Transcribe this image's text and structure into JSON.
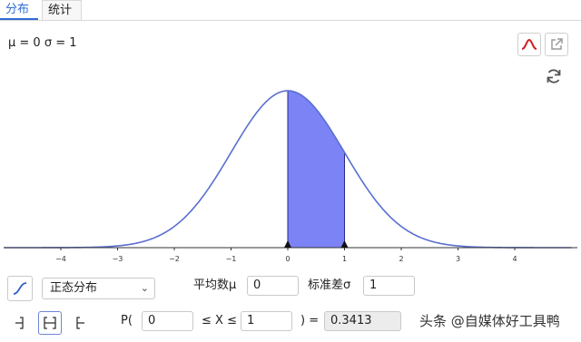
{
  "tabs": [
    {
      "label": "分布",
      "active": true
    },
    {
      "label": "统计",
      "active": false
    }
  ],
  "params_label": "μ = 0 σ = 1",
  "toolbar": {
    "curve_icon": "normal-curve-icon",
    "export_icon": "export-icon",
    "refresh_icon": "refresh-icon"
  },
  "chart_data": {
    "type": "area",
    "distribution": "normal",
    "mean": 0,
    "sd": 1,
    "x_ticks": [
      "−4",
      "−3",
      "−2",
      "−1",
      "0",
      "1",
      "2",
      "3",
      "4"
    ],
    "x_tick_values": [
      -4,
      -3,
      -2,
      -1,
      0,
      1,
      2,
      3,
      4
    ],
    "xlim": [
      -5,
      5
    ],
    "shaded_interval": [
      0,
      1
    ],
    "curve_color": "#5a6fd0",
    "fill_color": "#7b83f5"
  },
  "controls": {
    "distribution_select": "正态分布",
    "mean_label": "平均数μ",
    "mean_value": "0",
    "sd_label": "标准差σ",
    "sd_value": "1",
    "prob_prefix": "P(",
    "lower_value": "0",
    "between_label": "≤ X ≤",
    "upper_value": "1",
    "equals_label": ") =",
    "result_value": "0.3413",
    "bracket_buttons": [
      "left-sided",
      "interval",
      "right-sided"
    ]
  },
  "watermark": "头条 @自媒体好工具鸭"
}
